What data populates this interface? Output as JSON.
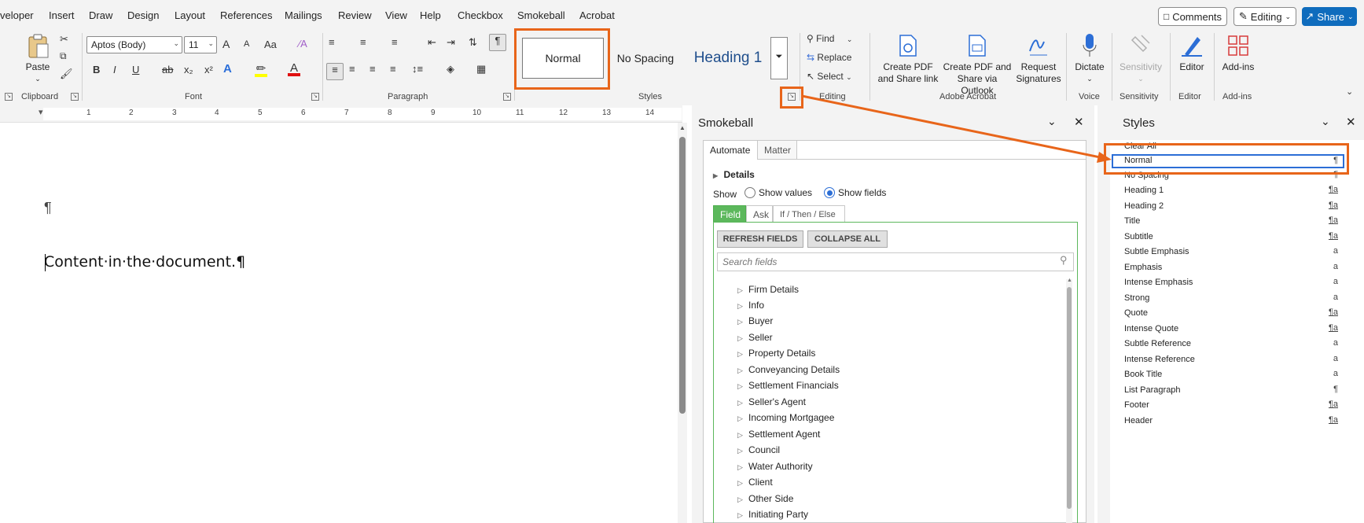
{
  "tabs": [
    "veloper",
    "Insert",
    "Draw",
    "Design",
    "Layout",
    "References",
    "Mailings",
    "Review",
    "View",
    "Help",
    "Checkbox",
    "Smokeball",
    "Acrobat"
  ],
  "top_buttons": {
    "comments": "Comments",
    "editing": "Editing",
    "share": "Share"
  },
  "ribbon": {
    "clipboard": {
      "paste": "Paste",
      "label": "Clipboard"
    },
    "font": {
      "family": "Aptos (Body)",
      "size": "11",
      "label": "Font",
      "grow": "A",
      "shrink": "A",
      "case": "Aa",
      "bold": "B",
      "italic": "I",
      "underline": "U",
      "strike": "ab",
      "sub": "x₂",
      "sup": "x²"
    },
    "paragraph": {
      "label": "Paragraph"
    },
    "styles": {
      "items": [
        "Normal",
        "No Spacing",
        "Heading 1"
      ],
      "label": "Styles"
    },
    "editing": {
      "find": "Find",
      "replace": "Replace",
      "select": "Select",
      "label": "Editing"
    },
    "acrobat": {
      "create_pdf_share": "Create PDF and Share link",
      "create_pdf_outlook": "Create PDF and Share via Outlook",
      "request_signatures": "Request Signatures",
      "label": "Adobe Acrobat"
    },
    "voice": {
      "dictate": "Dictate",
      "label": "Voice"
    },
    "sensitivity": {
      "button": "Sensitivity",
      "label": "Sensitivity"
    },
    "editor": {
      "button": "Editor",
      "label": "Editor"
    },
    "addins": {
      "button": "Add-ins",
      "label": "Add-ins"
    }
  },
  "ruler_numbers": [
    "1",
    "1",
    "2",
    "3",
    "4",
    "5",
    "6",
    "7",
    "8",
    "9",
    "10",
    "11",
    "12",
    "13",
    "14",
    "15"
  ],
  "document": {
    "pilcrow": "¶",
    "content": "Content·in·the·document.¶"
  },
  "smokeball": {
    "title": "Smokeball",
    "tabs": [
      "Automate",
      "Matter"
    ],
    "details": "Details",
    "show_label": "Show",
    "show_values": "Show values",
    "show_fields": "Show fields",
    "subtabs": [
      "Field",
      "Ask",
      "If / Then / Else"
    ],
    "refresh": "REFRESH FIELDS",
    "collapse": "COLLAPSE ALL",
    "search_placeholder": "Search fields",
    "tree": [
      "Firm Details",
      "Info",
      "Buyer",
      "Seller",
      "Property Details",
      "Conveyancing Details",
      "Settlement Financials",
      "Seller's Agent",
      "Incoming Mortgagee",
      "Settlement Agent",
      "Council",
      "Water Authority",
      "Client",
      "Other Side",
      "Initiating Party"
    ]
  },
  "styles_pane": {
    "title": "Styles",
    "items": [
      {
        "name": "Clear All",
        "glyph": ""
      },
      {
        "name": "Normal",
        "glyph": "¶"
      },
      {
        "name": "No Spacing",
        "glyph": "¶"
      },
      {
        "name": "Heading 1",
        "glyph": "¶a"
      },
      {
        "name": "Heading 2",
        "glyph": "¶a"
      },
      {
        "name": "Title",
        "glyph": "¶a"
      },
      {
        "name": "Subtitle",
        "glyph": "¶a"
      },
      {
        "name": "Subtle Emphasis",
        "glyph": "a"
      },
      {
        "name": "Emphasis",
        "glyph": "a"
      },
      {
        "name": "Intense Emphasis",
        "glyph": "a"
      },
      {
        "name": "Strong",
        "glyph": "a"
      },
      {
        "name": "Quote",
        "glyph": "¶a"
      },
      {
        "name": "Intense Quote",
        "glyph": "¶a"
      },
      {
        "name": "Subtle Reference",
        "glyph": "a"
      },
      {
        "name": "Intense Reference",
        "glyph": "a"
      },
      {
        "name": "Book Title",
        "glyph": "a"
      },
      {
        "name": "List Paragraph",
        "glyph": "¶"
      },
      {
        "name": "Footer",
        "glyph": "¶a"
      },
      {
        "name": "Header",
        "glyph": "¶a"
      }
    ]
  },
  "colors": {
    "accent": "#e8651a",
    "share_blue": "#0f6cbd",
    "field_green": "#5cb85c"
  }
}
